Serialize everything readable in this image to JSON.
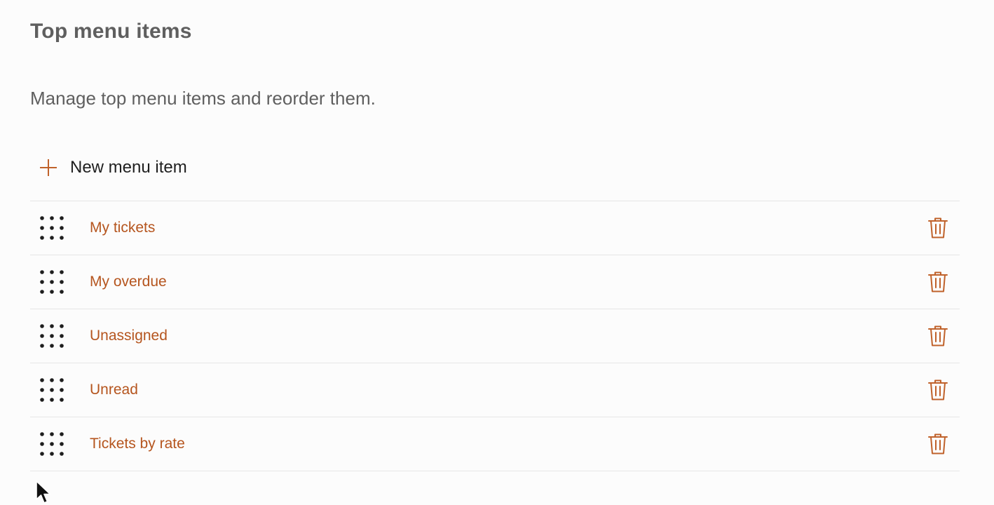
{
  "header": {
    "title": "Top menu items",
    "description": "Manage top menu items and reorder them."
  },
  "toolbar": {
    "new_item_label": "New menu item",
    "new_item_icon": "plus-icon"
  },
  "menu_items": [
    {
      "label": "My tickets"
    },
    {
      "label": "My overdue"
    },
    {
      "label": "Unassigned"
    },
    {
      "label": "Unread"
    },
    {
      "label": "Tickets by rate"
    }
  ],
  "icons": {
    "drag": "drag-handle-icon",
    "delete": "trash-icon"
  },
  "colors": {
    "accent": "#b5551e",
    "icon_accent": "#c0622b",
    "text": "#1f1f1f",
    "muted": "#5f5f5f",
    "divider": "#e6e6e6",
    "background": "#fcfcfc"
  }
}
